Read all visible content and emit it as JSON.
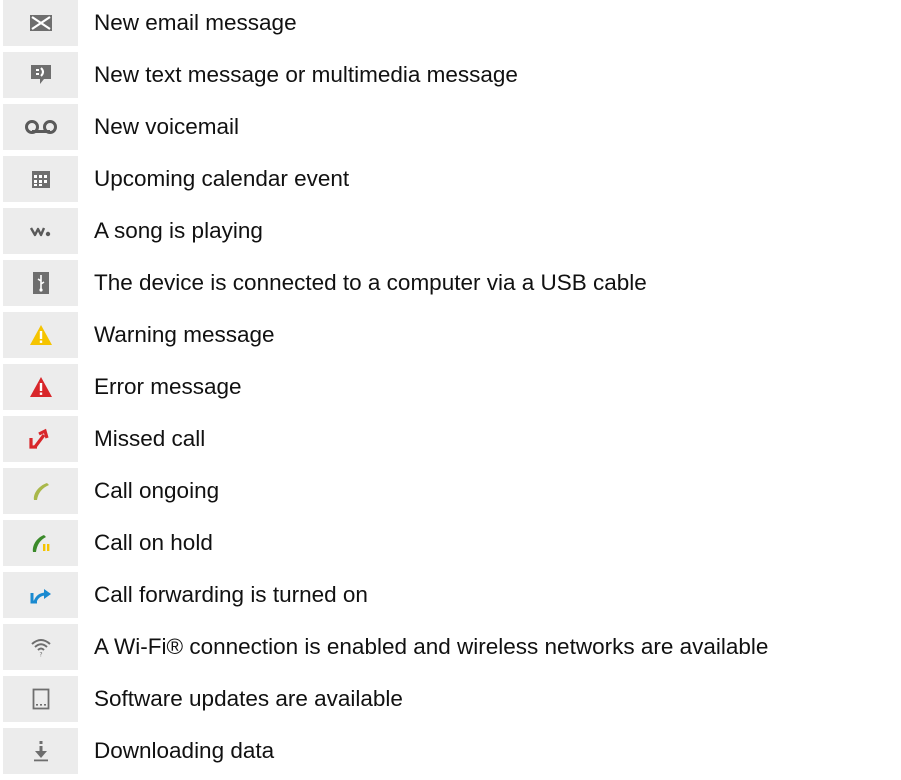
{
  "items": [
    {
      "icon": "email-icon",
      "label": "New email message"
    },
    {
      "icon": "text-message-icon",
      "label": "New text message or multimedia message"
    },
    {
      "icon": "voicemail-icon",
      "label": "New voicemail"
    },
    {
      "icon": "calendar-icon",
      "label": "Upcoming calendar event"
    },
    {
      "icon": "music-playing-icon",
      "label": "A song is playing"
    },
    {
      "icon": "usb-icon",
      "label": "The device is connected to a computer via a USB cable"
    },
    {
      "icon": "warning-icon",
      "label": "Warning message"
    },
    {
      "icon": "error-icon",
      "label": "Error message"
    },
    {
      "icon": "missed-call-icon",
      "label": "Missed call"
    },
    {
      "icon": "call-ongoing-icon",
      "label": "Call ongoing"
    },
    {
      "icon": "call-on-hold-icon",
      "label": "Call on hold"
    },
    {
      "icon": "call-forwarding-icon",
      "label": "Call forwarding is turned on"
    },
    {
      "icon": "wifi-icon",
      "label": "A Wi-Fi® connection is enabled and wireless networks are available"
    },
    {
      "icon": "software-update-icon",
      "label": "Software updates are available"
    },
    {
      "icon": "download-icon",
      "label": "Downloading data"
    }
  ],
  "colors": {
    "icon_cell_background": "#ececec",
    "icon_grey": "#6e6e6e",
    "warning": "#f5c400",
    "error": "#d8262a",
    "missed_call": "#d8262a",
    "call_ongoing": "#a9b84a",
    "call_on_hold": "#3b8a2a",
    "call_forwarding": "#1a8ad0"
  }
}
